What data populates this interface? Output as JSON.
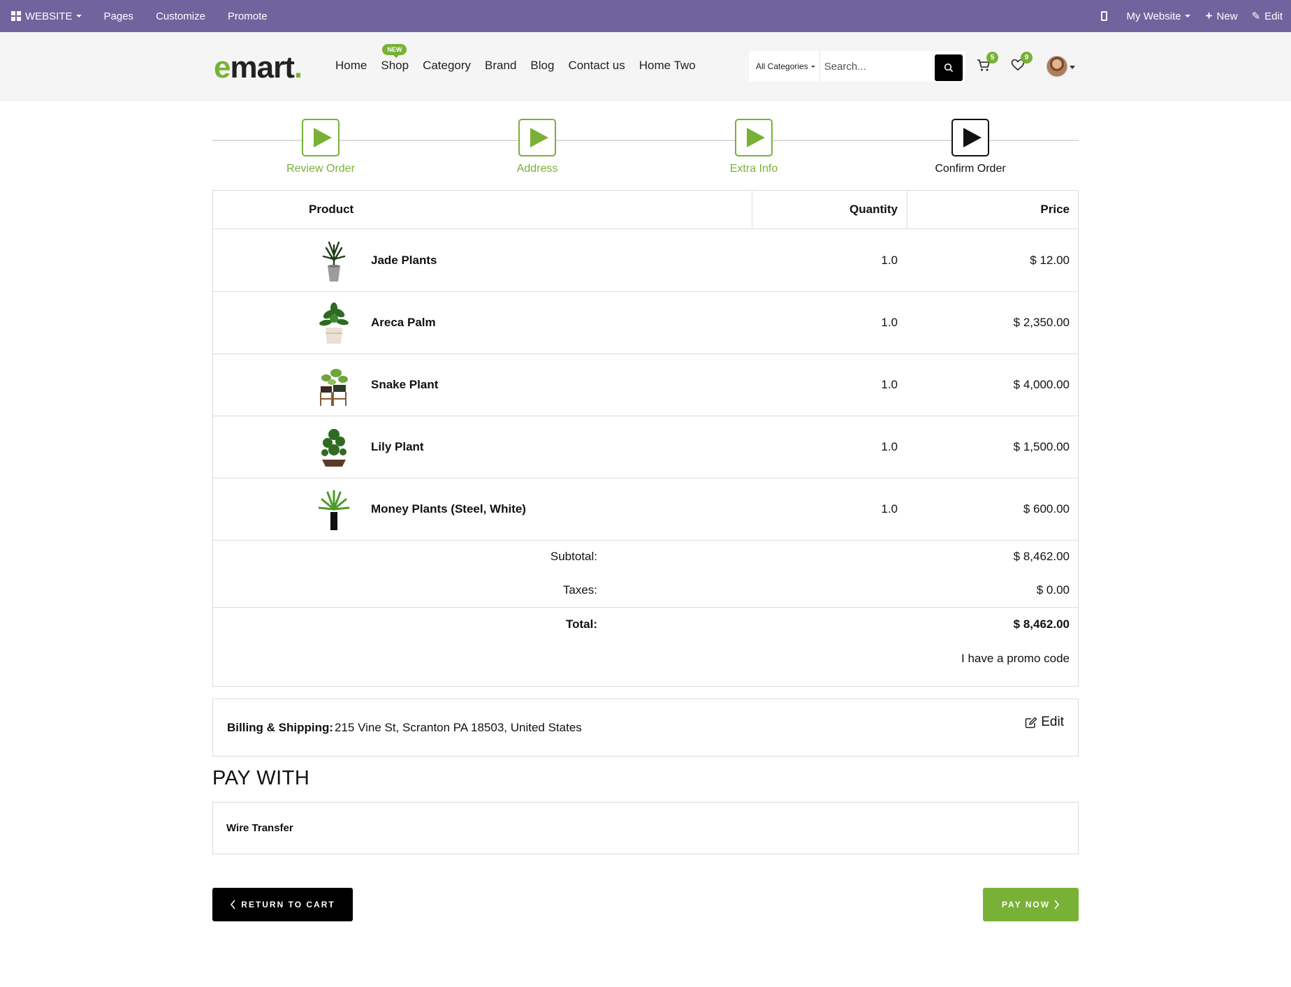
{
  "admin_bar": {
    "app_menu": "WEBSITE",
    "items": [
      "Pages",
      "Customize",
      "Promote"
    ],
    "site_switcher": "My Website",
    "new_label": "New",
    "edit_label": "Edit"
  },
  "header": {
    "logo_e": "e",
    "logo_rest": "mart",
    "logo_dot": ".",
    "nav": [
      "Home",
      "Shop",
      "Category",
      "Brand",
      "Blog",
      "Contact us",
      "Home Two"
    ],
    "shop_badge": "NEW",
    "search": {
      "category": "All Categories",
      "placeholder": "Search..."
    },
    "cart_count": "5",
    "wishlist_count": "9"
  },
  "steps": [
    {
      "label": "Review Order",
      "state": "done"
    },
    {
      "label": "Address",
      "state": "done"
    },
    {
      "label": "Extra Info",
      "state": "done"
    },
    {
      "label": "Confirm Order",
      "state": "active"
    }
  ],
  "order": {
    "columns": {
      "product": "Product",
      "quantity": "Quantity",
      "price": "Price"
    },
    "rows": [
      {
        "name": "Jade Plants",
        "qty": "1.0",
        "price": "$ 12.00",
        "icon": "jade-plant-image"
      },
      {
        "name": "Areca Palm",
        "qty": "1.0",
        "price": "$ 2,350.00",
        "icon": "areca-palm-image"
      },
      {
        "name": "Snake Plant",
        "qty": "1.0",
        "price": "$ 4,000.00",
        "icon": "snake-plant-image"
      },
      {
        "name": "Lily Plant",
        "qty": "1.0",
        "price": "$ 1,500.00",
        "icon": "lily-plant-image"
      },
      {
        "name": "Money Plants (Steel, White)",
        "qty": "1.0",
        "price": "$ 600.00",
        "icon": "money-plant-image"
      }
    ],
    "subtotal_label": "Subtotal:",
    "subtotal": "$ 8,462.00",
    "taxes_label": "Taxes:",
    "taxes": "$ 0.00",
    "total_label": "Total:",
    "total": "$ 8,462.00",
    "promo": "I have a promo code"
  },
  "billing": {
    "label": "Billing & Shipping:",
    "address": "215 Vine St, Scranton PA 18503, United States",
    "edit": "Edit"
  },
  "payment": {
    "heading": "PAY WITH",
    "option": "Wire Transfer"
  },
  "actions": {
    "return": "RETURN TO CART",
    "pay": "PAY NOW"
  },
  "colors": {
    "admin_bar": "#71639e",
    "accent": "#78b135",
    "header_bg": "#f5f5f5"
  }
}
